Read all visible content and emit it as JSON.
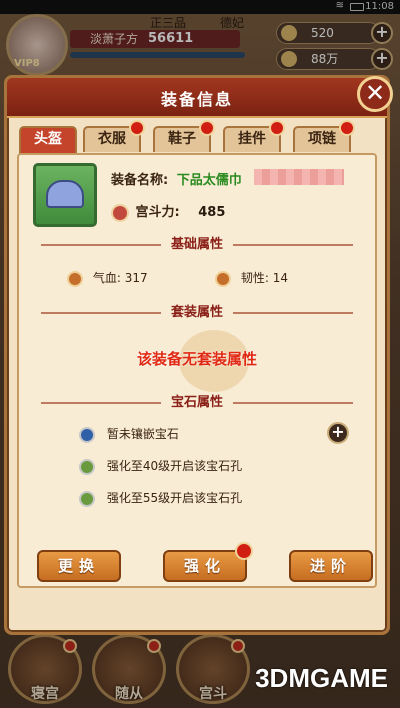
{
  "status_bar": {
    "time": "11:08"
  },
  "hud": {
    "vip": "VIP8",
    "rank_labels": [
      "正三品",
      "德妃"
    ],
    "player_name": "淡萧子方",
    "power": "56611",
    "resources": [
      {
        "icon": "ingot-icon",
        "value": "520"
      },
      {
        "icon": "coin-icon",
        "value": "88万"
      }
    ]
  },
  "dialog": {
    "title": "装备信息",
    "tabs": [
      {
        "label": "头盔",
        "active": true
      },
      {
        "label": "衣服",
        "active": false
      },
      {
        "label": "鞋子",
        "active": false
      },
      {
        "label": "挂件",
        "active": false
      },
      {
        "label": "项链",
        "active": false
      }
    ],
    "item": {
      "name_label": "装备名称:",
      "name_value": "下品太儒巾",
      "power_label": "宫斗力:",
      "power_value": "485"
    },
    "sections": {
      "base": "基础属性",
      "set": "套装属性",
      "gem": "宝石属性"
    },
    "stats": [
      {
        "label": "气血:",
        "value": "317"
      },
      {
        "label": "韧性:",
        "value": "14"
      }
    ],
    "set_text": "该装备无套装属性",
    "gems": [
      "暂未镶嵌宝石",
      "强化至40级开启该宝石孔",
      "强化至55级开启该宝石孔"
    ],
    "buttons": {
      "replace": "更换",
      "enhance": "强化",
      "advance": "进阶"
    }
  },
  "bottom_nav": [
    "寝宫",
    "随从",
    "宫斗"
  ],
  "watermark": "3DMGAME"
}
